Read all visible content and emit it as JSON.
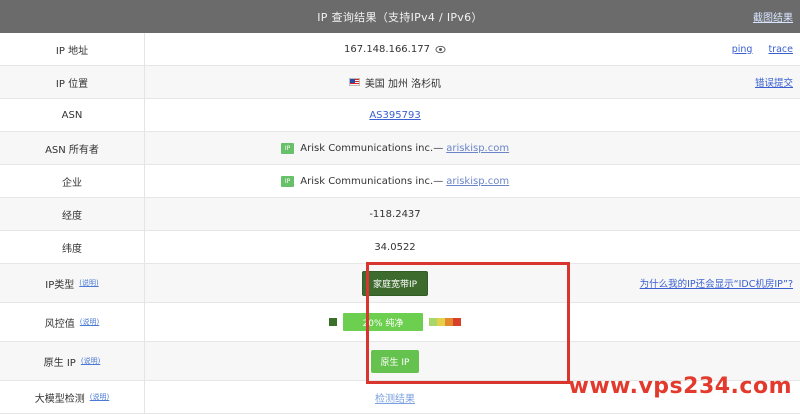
{
  "header": {
    "title": "IP 查询结果（支持IPv4 / IPv6）",
    "screenshot_link": "截图结果"
  },
  "rows": {
    "ip": {
      "label": "IP 地址",
      "value": "167.148.166.177",
      "actions": [
        "ping",
        "trace"
      ]
    },
    "location": {
      "label": "IP 位置",
      "value": "美国 加州 洛杉矶",
      "action": "错误提交"
    },
    "asn": {
      "label": "ASN",
      "value": "AS395793"
    },
    "asn_owner": {
      "label": "ASN 所有者",
      "badge": "IP",
      "value": "Arisk Communications inc.—",
      "link": "ariskisp.com"
    },
    "company": {
      "label": "企业",
      "badge": "IP",
      "value": "Arisk Communications inc.—",
      "link": "ariskisp.com"
    },
    "longitude": {
      "label": "经度",
      "value": "-118.2437"
    },
    "latitude": {
      "label": "纬度",
      "value": "34.0522"
    },
    "ip_type": {
      "label": "IP类型",
      "hint": "(说明)",
      "value": "家庭宽带IP",
      "action": "为什么我的IP还会显示“IDC机房IP”?"
    },
    "risk": {
      "label": "风控值",
      "hint": "(说明)",
      "value": "20%  纯净",
      "percent": 20
    },
    "native": {
      "label": "原生 IP",
      "hint": "(说明)",
      "value": "原生 IP"
    },
    "partial": {
      "label": "大模型检测",
      "hint": "(说明)",
      "value": "检测结果"
    }
  },
  "colors": {
    "header_bg": "#6b6b6b",
    "highlight_border": "#d7352e",
    "risk_green": "#6ccf4f",
    "type_dark": "#3d6b2e",
    "native_green": "#66c24e",
    "scale": [
      "#a8d66a",
      "#e4d04a",
      "#e38a2e",
      "#d8402b"
    ]
  },
  "icons": {
    "eye": "eye-icon",
    "flag": "us-flag-icon"
  },
  "watermark": "www.vps234.com"
}
